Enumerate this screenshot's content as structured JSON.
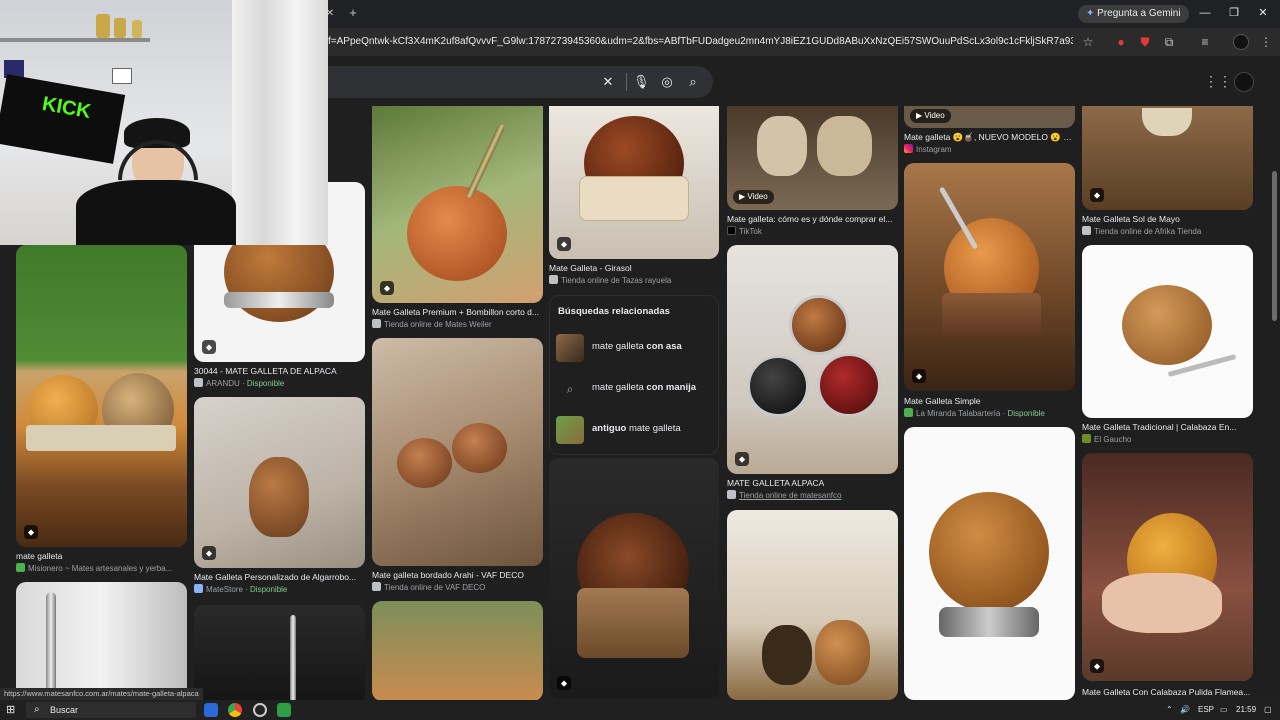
{
  "browser": {
    "url": "f=APpeQntwk-kCf3X4mK2uf8afQvvvF_G9lw:1787273945360&udm=2&fbs=ABfTbFUDadgeu2mn4mYJ8iEZ1GUDd8ABuXxNzQEi57SWOuuPdScLx3ol9c1cFkljSkR7a93EMURFD3x5suv...",
    "gemini_label": "Pregunta a Gemini"
  },
  "results": [
    {
      "id": "r1",
      "title": "mate galleta",
      "source": "Misionero ~ Mates artesanales y yerba...",
      "available": ""
    },
    {
      "id": "r2",
      "title": "30044 - MATE GALLETA DE ALPACA",
      "source": "ARANDU",
      "available": "Disponible"
    },
    {
      "id": "r3",
      "title": "Mate Galleta Personalizado de Algarrobo...",
      "source": "MateStore",
      "available": "Disponible"
    },
    {
      "id": "r4",
      "title": "Mate Galleta Premium + Bombillon corto d...",
      "source": "Tienda online de Mates Weiler",
      "available": ""
    },
    {
      "id": "r5",
      "title": "Mate galleta bordado Arahi - VAF DECO",
      "source": "Tienda online de VAF DECO",
      "available": ""
    },
    {
      "id": "r6",
      "title": "Mate Galleta - Girasol",
      "source": "Tienda online de Tazas rayuela",
      "available": ""
    },
    {
      "id": "r7",
      "title": "Mate galleta: cómo es y dónde comprar el...",
      "source": "TikTok",
      "available": ""
    },
    {
      "id": "r8",
      "title": "MATE GALLETA ALPACA",
      "source": "Tienda online de matesanfco",
      "available": ""
    },
    {
      "id": "r9",
      "title": "Mate galleta 😮🧉, NUEVO MODELO 😮 qu...",
      "source": "Instagram",
      "available": ""
    },
    {
      "id": "r10",
      "title": "Mate Galleta Simple",
      "source": "La Miranda Talabartería",
      "available": "Disponible"
    },
    {
      "id": "r11",
      "title": "Mate Galleta Sol de Mayo",
      "source": "Tienda online de Afrika Tienda",
      "available": ""
    },
    {
      "id": "r12",
      "title": "Mate Galleta Tradicional | Calabaza En...",
      "source": "El Gaucho",
      "available": ""
    },
    {
      "id": "r13",
      "title": "Mate Galleta Con Calabaza Pulida Flamea...",
      "source": "",
      "available": ""
    }
  ],
  "video_label": "Video",
  "related": {
    "title": "Búsquedas relacionadas",
    "items": [
      {
        "prefix": "mate galleta ",
        "bold": "con asa",
        "suffix": ""
      },
      {
        "prefix": "mate galleta ",
        "bold": "con manija",
        "suffix": ""
      },
      {
        "prefix": "",
        "bold": "antiguo",
        "suffix": " mate galleta"
      }
    ]
  },
  "status_link": "https://www.matesanfco.com.ar/mates/mate-galleta-alpaca",
  "taskbar": {
    "search_placeholder": "Buscar",
    "lang": "ESP",
    "time": "21:59"
  },
  "webcam_sign": "KICK"
}
